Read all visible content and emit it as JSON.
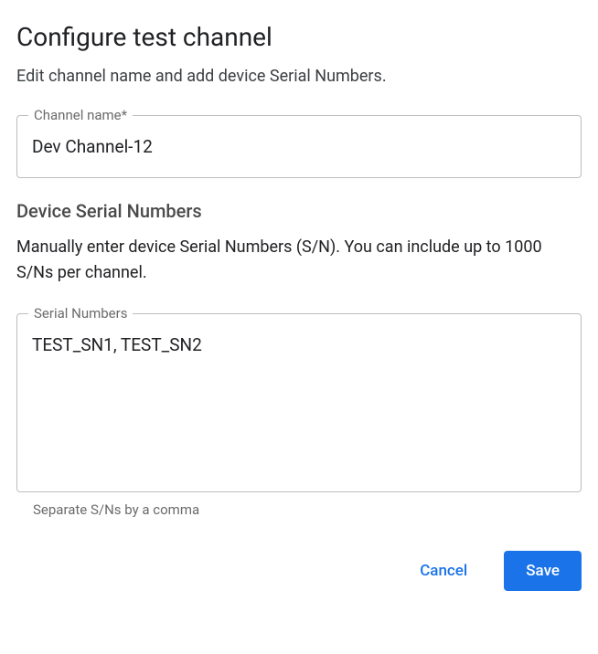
{
  "dialog": {
    "title": "Configure test channel",
    "subtitle": "Edit channel name and add device Serial Numbers."
  },
  "channel_name": {
    "label": "Channel name*",
    "value": "Dev Channel-12"
  },
  "serial_section": {
    "heading": "Device Serial Numbers",
    "description": "Manually enter device Serial Numbers (S/N). You can include up to 1000 S/Ns per channel.",
    "label": "Serial Numbers",
    "value": "TEST_SN1, TEST_SN2",
    "helper": "Separate S/Ns by a comma"
  },
  "buttons": {
    "cancel": "Cancel",
    "save": "Save"
  }
}
